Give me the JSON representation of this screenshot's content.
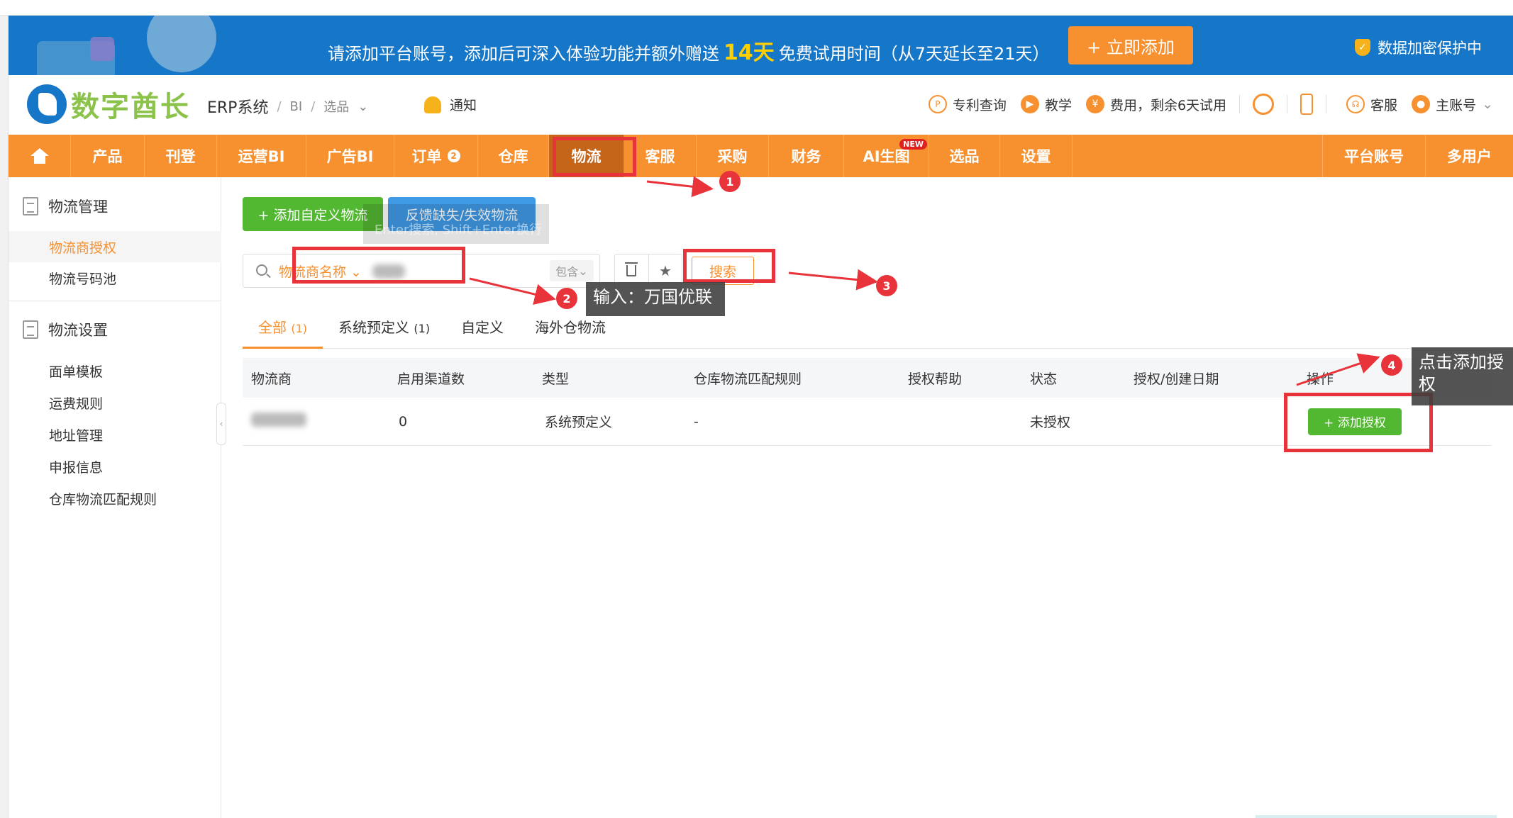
{
  "banner": {
    "text_before": "请添加平台账号，添加后可深入体验功能并额外赠送",
    "highlight": "14天",
    "text_after": "免费试用时间（从7天延长至21天）",
    "cta": "+ 立即添加",
    "secure": "数据加密保护中"
  },
  "header": {
    "logo_text": "数字酋长",
    "system": "ERP系统",
    "crumb_1": "BI",
    "crumb_2": "选品",
    "notice": "通知",
    "patent": "专利查询",
    "teach": "教学",
    "fee": "费用，剩余6天试用",
    "service": "客服",
    "account": "主账号"
  },
  "nav": {
    "items": [
      "产品",
      "刊登",
      "运营BI",
      "广告BI",
      "订单",
      "仓库",
      "物流",
      "客服",
      "采购",
      "财务",
      "AI生图",
      "选品",
      "设置"
    ],
    "order_badge": "2",
    "new_badge": "NEW",
    "right_items": [
      "平台账号",
      "多用户"
    ]
  },
  "sidebar": {
    "group1": "物流管理",
    "group1_items": [
      "物流商授权",
      "物流号码池"
    ],
    "group2": "物流设置",
    "group2_items": [
      "面单模板",
      "运费规则",
      "地址管理",
      "申报信息",
      "仓库物流匹配规则"
    ]
  },
  "toolbar": {
    "add_custom": "+ 添加自定义物流",
    "feedback": "反馈缺失/失效物流",
    "ghost_hint": "Enter搜索, Shift+Enter换行"
  },
  "search": {
    "field": "物流商名称",
    "contains": "包含",
    "button": "搜索"
  },
  "tabs": [
    {
      "label": "全部",
      "count": "(1)"
    },
    {
      "label": "系统预定义",
      "count": "(1)"
    },
    {
      "label": "自定义",
      "count": ""
    },
    {
      "label": "海外仓物流",
      "count": ""
    }
  ],
  "table": {
    "headers": [
      "物流商",
      "启用渠道数",
      "类型",
      "仓库物流匹配规则",
      "授权帮助",
      "状态",
      "授权/创建日期",
      "操作"
    ],
    "row": {
      "channels": "0",
      "type": "系统预定义",
      "rule": "-",
      "status": "未授权",
      "action": "+ 添加授权"
    }
  },
  "annotations": {
    "m1": "1",
    "m2": "2",
    "m3": "3",
    "m4": "4",
    "callout2": "输入：万国优联",
    "callout4": "点击添加授权"
  },
  "colors": {
    "brand_orange": "#f7902f",
    "banner_blue": "#1677c9",
    "green": "#52b731",
    "annotation_red": "#e8333a"
  }
}
